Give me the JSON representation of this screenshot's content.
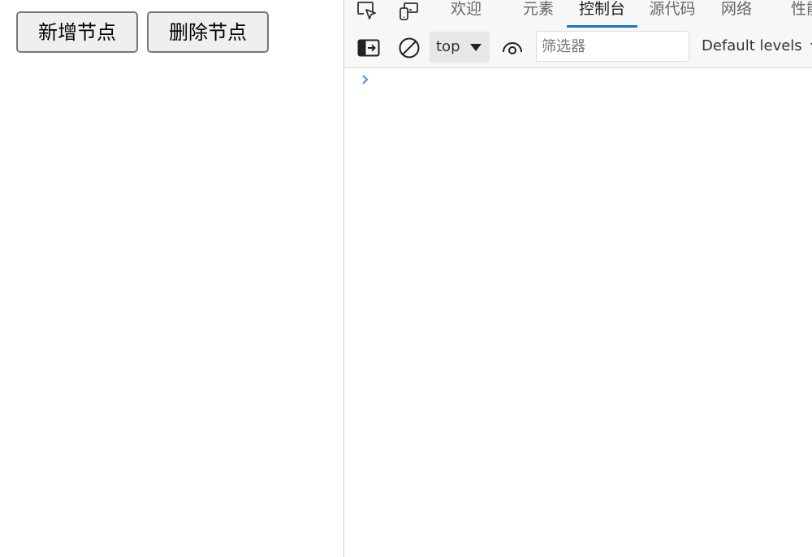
{
  "page": {
    "buttons": [
      {
        "label": "新增节点"
      },
      {
        "label": "删除节点"
      }
    ]
  },
  "devtools": {
    "tabbar": {
      "icons": [
        "inspect-element-icon",
        "device-toolbar-icon"
      ],
      "tabs": [
        {
          "label": "欢迎",
          "active": false
        },
        {
          "label": "元素",
          "active": false
        },
        {
          "label": "控制台",
          "active": true
        },
        {
          "label": "源代码",
          "active": false
        },
        {
          "label": "网络",
          "active": false
        },
        {
          "label": "性能",
          "active": false
        }
      ]
    },
    "toolbar": {
      "context": "top",
      "filter_placeholder": "筛选器",
      "filter_value": "",
      "levels": "Default levels"
    },
    "colors": {
      "accent": "#1a73c8",
      "prompt": "#4a90d9"
    }
  }
}
